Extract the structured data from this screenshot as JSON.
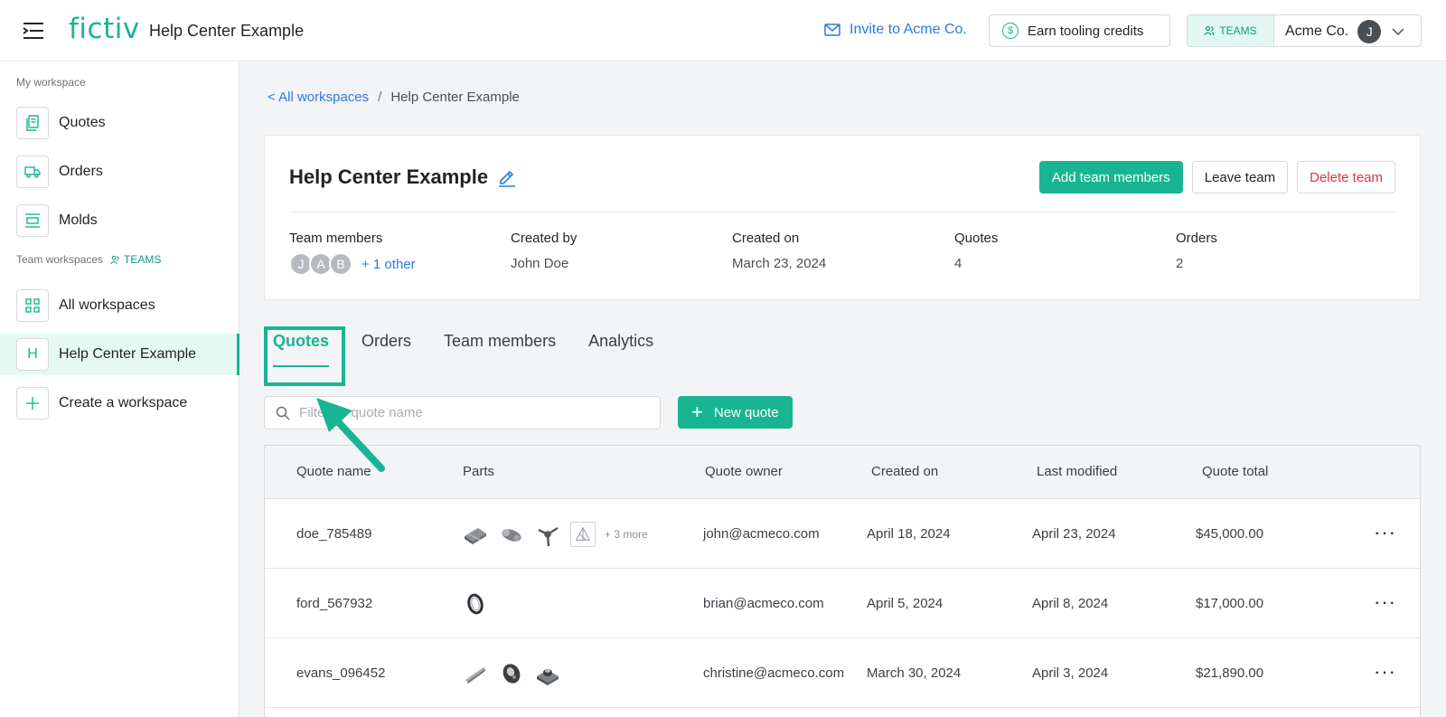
{
  "header": {
    "logo": "fictiv",
    "title": "Help Center Example",
    "invite_label": "Invite to Acme Co.",
    "earn_label": "Earn tooling credits",
    "teams_badge": "TEAMS",
    "org_name": "Acme Co.",
    "user_initial": "J"
  },
  "sidebar": {
    "my_workspace_heading": "My workspace",
    "my_items": [
      {
        "label": "Quotes",
        "icon": "quotes-icon"
      },
      {
        "label": "Orders",
        "icon": "truck-icon"
      },
      {
        "label": "Molds",
        "icon": "molds-icon"
      }
    ],
    "team_heading": "Team workspaces",
    "team_badge": "TEAMS",
    "team_items": [
      {
        "label": "All workspaces",
        "icon": "grid-icon"
      },
      {
        "label": "Help Center Example",
        "initial": "H",
        "active": true
      },
      {
        "label": "Create a workspace",
        "icon": "plus-icon"
      }
    ]
  },
  "breadcrumb": {
    "back_label": "All workspaces",
    "separator": "/",
    "current": "Help Center Example"
  },
  "team": {
    "name": "Help Center Example",
    "actions": {
      "add": "Add team members",
      "leave": "Leave team",
      "delete": "Delete team"
    },
    "stats": {
      "members_label": "Team members",
      "member_initials": [
        "J",
        "A",
        "B"
      ],
      "others_label": "+ 1 other",
      "created_by_label": "Created by",
      "created_by": "John Doe",
      "created_on_label": "Created on",
      "created_on": "March 23, 2024",
      "quotes_label": "Quotes",
      "quotes": "4",
      "orders_label": "Orders",
      "orders": "2"
    }
  },
  "tabs": [
    {
      "label": "Quotes",
      "active": true
    },
    {
      "label": "Orders"
    },
    {
      "label": "Team members"
    },
    {
      "label": "Analytics"
    }
  ],
  "filter": {
    "placeholder": "Filter by quote name",
    "new_quote_label": "New quote"
  },
  "table": {
    "columns": [
      "Quote name",
      "Parts",
      "Quote owner",
      "Created on",
      "Last modified",
      "Quote total"
    ],
    "rows": [
      {
        "name": "doe_785489",
        "more_parts": "+ 3 more",
        "owner": "john@acmeco.com",
        "created": "April 18, 2024",
        "modified": "April 23, 2024",
        "total": "$45,000.00"
      },
      {
        "name": "ford_567932",
        "more_parts": "",
        "owner": "brian@acmeco.com",
        "created": "April 5, 2024",
        "modified": "April 8, 2024",
        "total": "$17,000.00"
      },
      {
        "name": "evans_096452",
        "more_parts": "",
        "owner": "christine@acmeco.com",
        "created": "March 30, 2024",
        "modified": "April 3, 2024",
        "total": "$21,890.00"
      }
    ],
    "row_menu": "···"
  },
  "colors": {
    "accent": "#19b592",
    "link": "#2c79e6",
    "danger": "#e0323f"
  }
}
